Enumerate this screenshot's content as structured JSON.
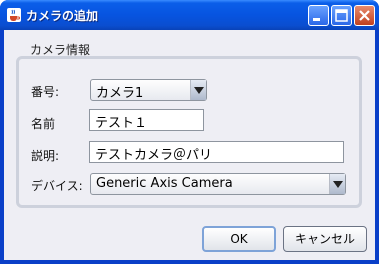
{
  "window": {
    "title": "カメラの追加"
  },
  "group": {
    "title": "カメラ情報"
  },
  "form": {
    "number_label": "番号:",
    "number_value": "カメラ1",
    "name_label": "名前",
    "name_value": "テスト１",
    "desc_label": "説明:",
    "desc_value": "テストカメラ＠パリ",
    "device_label": "デバイス:",
    "device_value": "Generic Axis Camera"
  },
  "buttons": {
    "ok": "OK",
    "cancel": "キャンセル"
  },
  "icons": {
    "app": "java-cup-icon",
    "minimize": "minimize-icon",
    "maximize": "maximize-icon",
    "close": "close-icon"
  },
  "colors": {
    "titlebar": "#0754e0",
    "client_bg": "#eeeef4",
    "group_border": "#cdd1dc"
  }
}
